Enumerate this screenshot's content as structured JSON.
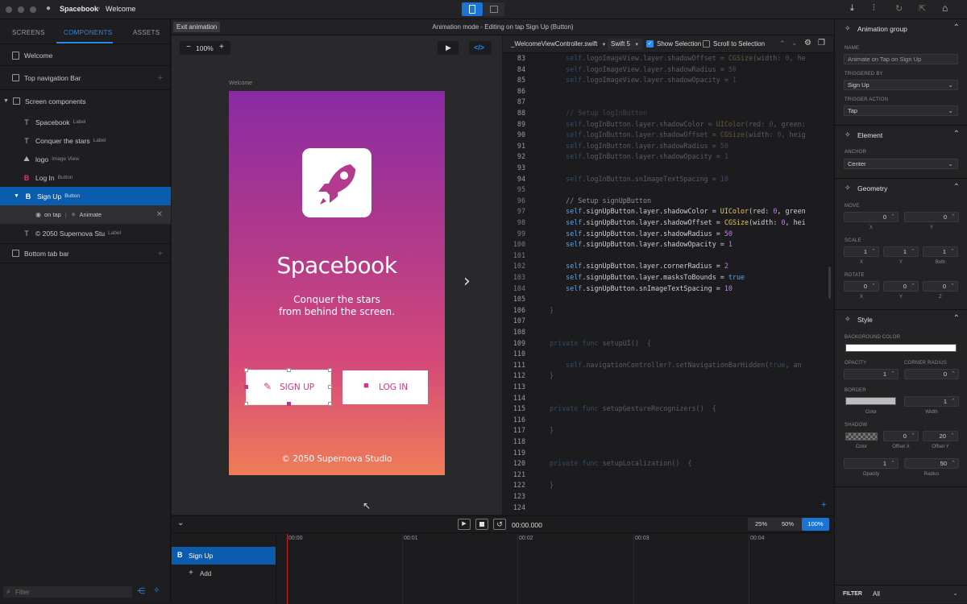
{
  "window": {
    "app_name": "Spacebook",
    "breadcrumb_sep": "›",
    "screen": "Welcome"
  },
  "toolbar_right_icons": [
    "download-icon",
    "sliders-icon",
    "refresh-icon",
    "external-icon",
    "graduation-icon"
  ],
  "left_tabs": [
    "SCREENS",
    "COMPONENTS",
    "ASSETS"
  ],
  "tree": {
    "welcome": "Welcome",
    "top_nav": "Top navigation Bar",
    "screen_components": "Screen components",
    "items": [
      {
        "label": "Spacebook",
        "type": "Label",
        "icon": "T"
      },
      {
        "label": "Conquer the stars",
        "type": "Label",
        "icon": "T"
      },
      {
        "label": "logo",
        "type": "Image View",
        "icon": "⛰"
      },
      {
        "label": "Log In",
        "type": "Button",
        "icon": "B"
      },
      {
        "label": "Sign Up",
        "type": "Button",
        "icon": "B"
      }
    ],
    "animation": {
      "trigger": "on tap",
      "sep": "|",
      "action": "Animate"
    },
    "footer_label": {
      "label": "© 2050 Supernova Stu",
      "type": "Label",
      "icon": "T"
    },
    "bottom_tab": "Bottom tab bar"
  },
  "filter_placeholder": "Filter",
  "canvas": {
    "exit_label": "Exit animation",
    "mode_title": "Animation mode - Editing on tap Sign Up (Button)",
    "zoom": "100%",
    "zoom_minus": "−",
    "zoom_plus": "+",
    "screen_label": "Welcome",
    "phone": {
      "title": "Spacebook",
      "subtitle_1": "Conquer the stars",
      "subtitle_2": "from behind the screen.",
      "signup": "SIGN UP",
      "login": "LOG IN",
      "footer": "© 2050 Supernova Studio"
    }
  },
  "code": {
    "file": "_WelcomeViewController.swift",
    "lang": "Swift 5",
    "show_selection": "Show Selection",
    "scroll_to_selection": "Scroll to Selection",
    "lines": [
      {
        "n": "83",
        "t": "    self.logoImageView.layer.shadowOffset = CGSize(width: 0, he",
        "dim": true
      },
      {
        "n": "84",
        "t": "    self.logoImageView.layer.shadowRadius = 50",
        "dim": true
      },
      {
        "n": "85",
        "t": "    self.logoImageView.layer.shadowOpacity = 1",
        "dim": true
      },
      {
        "n": "86",
        "t": "",
        "dim": true
      },
      {
        "n": "87",
        "t": "",
        "dim": true
      },
      {
        "n": "88",
        "t": "    // Setup logInButton",
        "dim": true
      },
      {
        "n": "89",
        "t": "    self.logInButton.layer.shadowColor = UIColor(red: 0, green:",
        "dim": true
      },
      {
        "n": "90",
        "t": "    self.logInButton.layer.shadowOffset = CGSize(width: 0, heig",
        "dim": true
      },
      {
        "n": "91",
        "t": "    self.logInButton.layer.shadowRadius = 50",
        "dim": true
      },
      {
        "n": "92",
        "t": "    self.logInButton.layer.shadowOpacity = 1",
        "dim": true
      },
      {
        "n": "93",
        "t": "",
        "dim": true
      },
      {
        "n": "94",
        "t": "    self.logInButton.snImageTextSpacing = 10",
        "dim": true
      },
      {
        "n": "95",
        "t": "",
        "dim": false
      },
      {
        "n": "96",
        "t": "    // Setup signUpButton",
        "dim": false
      },
      {
        "n": "97",
        "t": "    self.signUpButton.layer.shadowColor = UIColor(red: 0, green",
        "dim": false
      },
      {
        "n": "98",
        "t": "    self.signUpButton.layer.shadowOffset = CGSize(width: 0, hei",
        "dim": false
      },
      {
        "n": "99",
        "t": "    self.signUpButton.layer.shadowRadius = 50",
        "dim": false
      },
      {
        "n": "100",
        "t": "    self.signUpButton.layer.shadowOpacity = 1",
        "dim": false
      },
      {
        "n": "101",
        "t": "",
        "dim": false
      },
      {
        "n": "102",
        "t": "    self.signUpButton.layer.cornerRadius = 2",
        "dim": false
      },
      {
        "n": "103",
        "t": "    self.signUpButton.layer.masksToBounds = true",
        "dim": false
      },
      {
        "n": "104",
        "t": "    self.signUpButton.snImageTextSpacing = 10",
        "dim": false
      },
      {
        "n": "105",
        "t": "",
        "dim": true
      },
      {
        "n": "106",
        "t": "}",
        "dim": true
      },
      {
        "n": "107",
        "t": "",
        "dim": true
      },
      {
        "n": "108",
        "t": "",
        "dim": true
      },
      {
        "n": "109",
        "t": "private func setupUI()  {",
        "dim": true
      },
      {
        "n": "110",
        "t": "",
        "dim": true
      },
      {
        "n": "111",
        "t": "    self.navigationController?.setNavigationBarHidden(true, an",
        "dim": true
      },
      {
        "n": "112",
        "t": "}",
        "dim": true
      },
      {
        "n": "113",
        "t": "",
        "dim": true
      },
      {
        "n": "114",
        "t": "",
        "dim": true
      },
      {
        "n": "115",
        "t": "private func setupGestureRecognizers()  {",
        "dim": true
      },
      {
        "n": "116",
        "t": "",
        "dim": true
      },
      {
        "n": "117",
        "t": "}",
        "dim": true
      },
      {
        "n": "118",
        "t": "",
        "dim": true
      },
      {
        "n": "119",
        "t": "",
        "dim": true
      },
      {
        "n": "120",
        "t": "private func setupLocalization()  {",
        "dim": true
      },
      {
        "n": "121",
        "t": "",
        "dim": true
      },
      {
        "n": "122",
        "t": "}",
        "dim": true
      },
      {
        "n": "123",
        "t": "",
        "dim": true
      },
      {
        "n": "124",
        "t": "",
        "dim": true
      }
    ]
  },
  "inspector": {
    "animation_group": "Animation group",
    "name_label": "NAME",
    "name_value": "Animate on Tap on Sign Up",
    "triggered_by_label": "TRIGGERED BY",
    "triggered_by": "Sign Up",
    "trigger_action_label": "TRIGGER ACTION",
    "trigger_action": "Tap",
    "element": "Element",
    "anchor_label": "ANCHOR",
    "anchor": "Center",
    "geometry": "Geometry",
    "move_label": "MOVE",
    "move": [
      "0",
      "0"
    ],
    "move_axes": [
      "X",
      "Y"
    ],
    "scale_label": "SCALE",
    "scale": [
      "1",
      "1",
      "1"
    ],
    "scale_axes": [
      "X",
      "Y",
      "Both"
    ],
    "rotate_label": "ROTATE",
    "rotate": [
      "0",
      "0",
      "0"
    ],
    "rotate_axes": [
      "X",
      "Y",
      "Z"
    ],
    "style": "Style",
    "bg_label": "BACKGROUND COLOR",
    "opacity_label": "OPACITY",
    "opacity": "1",
    "corner_label": "CORNER RADIUS",
    "corner": "0",
    "border_label": "BORDER",
    "border_width": "1",
    "border_sub": [
      "Color",
      "Width"
    ],
    "shadow_label": "SHADOW",
    "shadow_offset_x": "0",
    "shadow_offset_y": "20",
    "shadow_sub": [
      "Color",
      "Offset X",
      "Offset Y"
    ],
    "shadow_opacity": "1",
    "shadow_radius": "50",
    "shadow_sub2": [
      "Opacity",
      "Radius"
    ],
    "filter_label": "FILTER",
    "filter_value": "All"
  },
  "timeline": {
    "time": "00:00.000",
    "zooms": [
      "25%",
      "50%",
      "100%"
    ],
    "ticks": [
      "00:00",
      "00:01",
      "00:02",
      "00:03",
      "00:04"
    ],
    "track": "Sign Up",
    "track_icon": "B",
    "add": "Add"
  },
  "colors": {
    "accent": "#1a74d4",
    "selection": "#0b5cad",
    "gradient_top": "#8a2aa3",
    "gradient_bottom": "#f07c58",
    "signup_pink": "#d8348a"
  }
}
